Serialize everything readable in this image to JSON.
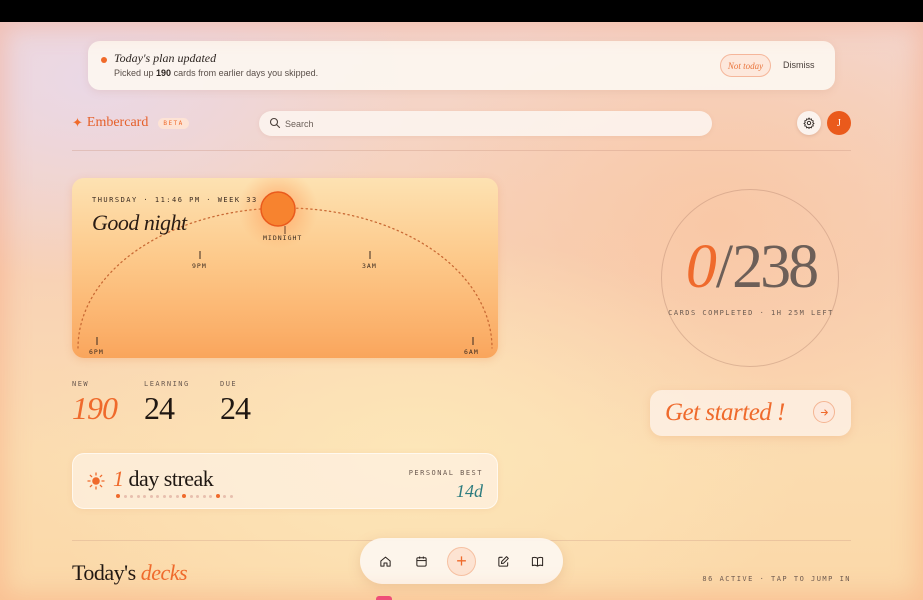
{
  "notice": {
    "title": "Today's plan updated",
    "body_prefix": "Picked up ",
    "body_count": "190",
    "body_suffix": " cards from earlier days you skipped.",
    "not_today_label": "Not today",
    "dismiss_label": "Dismiss"
  },
  "header": {
    "brand_name": "Embercard",
    "beta_badge": "BETA",
    "search_placeholder": "Search",
    "avatar_initial": "J"
  },
  "sun_card": {
    "meta": "THURSDAY · 11:46 PM · WEEK 33",
    "greeting": "Good night",
    "time_marks": [
      "6PM",
      "9PM",
      "MIDNIGHT",
      "3AM",
      "6AM"
    ],
    "sun_color": "#f36b21"
  },
  "stats": [
    {
      "label": "NEW",
      "value": "190"
    },
    {
      "label": "LEARNING",
      "value": "24"
    },
    {
      "label": "DUE",
      "value": "24"
    }
  ],
  "streak": {
    "count": "1",
    "text": "day streak",
    "best_label": "PERSONAL BEST",
    "best_value": "14d"
  },
  "progress": {
    "completed": "0",
    "total": "238",
    "subtitle": "CARDS COMPLETED · 1H 25M LEFT"
  },
  "cta": {
    "label": "Get started !",
    "arrow_icon": "arrow-right-icon"
  },
  "decks": {
    "title_plain": "Today's ",
    "title_accent": "decks",
    "meta": "86 ACTIVE · TAP TO JUMP IN"
  },
  "bottom_nav": {
    "items": [
      "home-icon",
      "calendar-icon",
      "plus-icon",
      "edit-icon",
      "book-icon"
    ],
    "add_label": "+"
  },
  "colors": {
    "accent": "#ef6a2c",
    "teal": "#2c7b7e"
  }
}
